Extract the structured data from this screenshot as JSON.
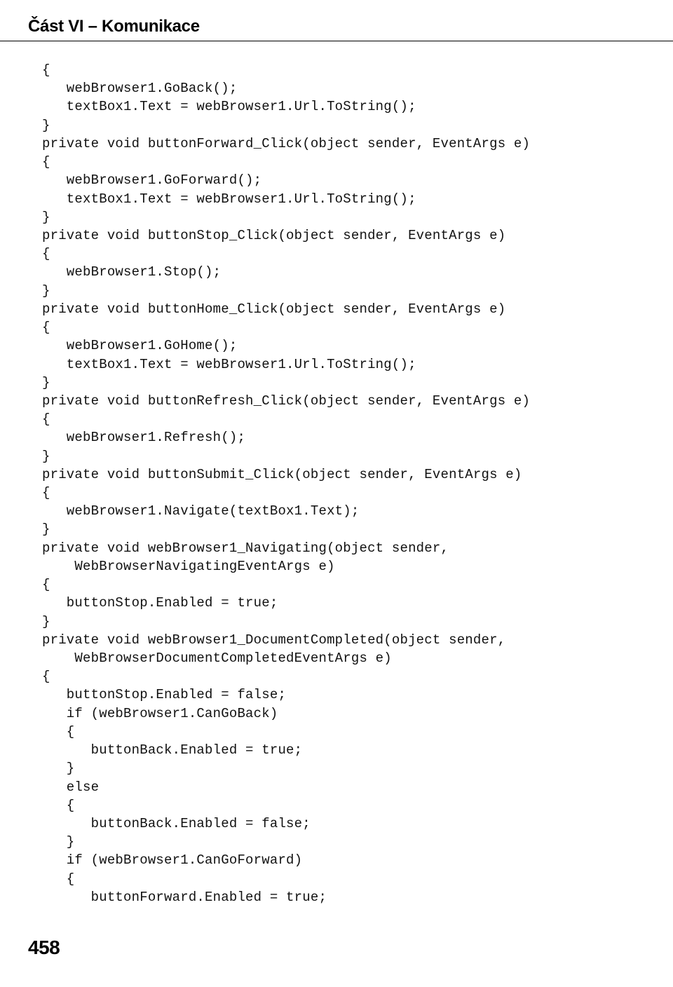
{
  "header": {
    "title": "Část VI – Komunikace"
  },
  "page": {
    "number": "458"
  },
  "code": {
    "lines": [
      "{",
      "   webBrowser1.GoBack();",
      "   textBox1.Text = webBrowser1.Url.ToString();",
      "}",
      "private void buttonForward_Click(object sender, EventArgs e)",
      "{",
      "   webBrowser1.GoForward();",
      "   textBox1.Text = webBrowser1.Url.ToString();",
      "}",
      "private void buttonStop_Click(object sender, EventArgs e)",
      "{",
      "   webBrowser1.Stop();",
      "}",
      "private void buttonHome_Click(object sender, EventArgs e)",
      "{",
      "   webBrowser1.GoHome();",
      "   textBox1.Text = webBrowser1.Url.ToString();",
      "}",
      "private void buttonRefresh_Click(object sender, EventArgs e)",
      "{",
      "   webBrowser1.Refresh();",
      "}",
      "private void buttonSubmit_Click(object sender, EventArgs e)",
      "{",
      "   webBrowser1.Navigate(textBox1.Text);",
      "}",
      "private void webBrowser1_Navigating(object sender,",
      "    WebBrowserNavigatingEventArgs e)",
      "{",
      "   buttonStop.Enabled = true;",
      "}",
      "private void webBrowser1_DocumentCompleted(object sender,",
      "    WebBrowserDocumentCompletedEventArgs e)",
      "{",
      "   buttonStop.Enabled = false;",
      "   if (webBrowser1.CanGoBack)",
      "   {",
      "      buttonBack.Enabled = true;",
      "   }",
      "   else",
      "   {",
      "      buttonBack.Enabled = false;",
      "   }",
      "   if (webBrowser1.CanGoForward)",
      "   {",
      "      buttonForward.Enabled = true;"
    ]
  }
}
